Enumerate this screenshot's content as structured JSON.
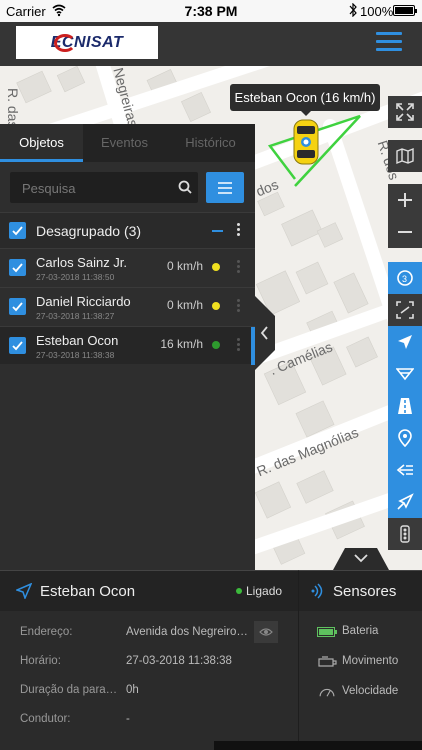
{
  "status_bar": {
    "carrier": "Carrier",
    "time": "7:38 PM"
  },
  "header": {
    "logo_text": "ECNISAT",
    "menu_icon": "hamburger-icon",
    "accent": "#2f8fe0"
  },
  "map": {
    "tooltip": "Esteban Ocon (16 km/h)",
    "streets": [
      "R. das O",
      "R. dos Negreiros",
      "R. dos",
      "R. das Camélias",
      "R. das Magnólias",
      "dos"
    ],
    "tools": [
      "fullscreen-icon",
      "map-layers-icon",
      "zoom-in-icon",
      "zoom-out-icon",
      "speed-icon",
      "fit-screen-icon",
      "navigate-icon",
      "route-icon",
      "road-icon",
      "location-pin-icon",
      "history-icon",
      "direction-icon",
      "traffic-light-icon"
    ]
  },
  "panel": {
    "tabs": [
      {
        "label": "Objetos",
        "active": true
      },
      {
        "label": "Eventos",
        "active": false
      },
      {
        "label": "Histórico",
        "active": false
      }
    ],
    "search": {
      "placeholder": "Pesquisa"
    },
    "group": {
      "label": "Desagrupado (3)",
      "checked": true
    },
    "objects": [
      {
        "name": "Carlos Sainz Jr.",
        "date": "27-03-2018 11:38:50",
        "speed": "0 km/h",
        "status_color": "#f0e020"
      },
      {
        "name": "Daniel Ricciardo",
        "date": "27-03-2018 11:38:27",
        "speed": "0 km/h",
        "status_color": "#f0e020"
      },
      {
        "name": "Esteban Ocon",
        "date": "27-03-2018 11:38:38",
        "speed": "16 km/h",
        "status_color": "#2e9a2e"
      }
    ]
  },
  "details": {
    "title": "Esteban Ocon",
    "status": "Ligado",
    "rows": [
      {
        "label": "Endereço:",
        "value": "Avenida dos Negreiros..."
      },
      {
        "label": "Horário:",
        "value": "27-03-2018 11:38:38"
      },
      {
        "label": "Duração da parada:",
        "value": "0h"
      },
      {
        "label": "Condutor:",
        "value": "-"
      }
    ]
  },
  "sensors": {
    "title": "Sensores",
    "items": [
      {
        "label": "Bateria",
        "icon": "battery-icon",
        "color": "#5fc15f"
      },
      {
        "label": "Movimento",
        "icon": "engine-icon"
      },
      {
        "label": "Velocidade",
        "icon": "speedometer-icon"
      }
    ]
  }
}
